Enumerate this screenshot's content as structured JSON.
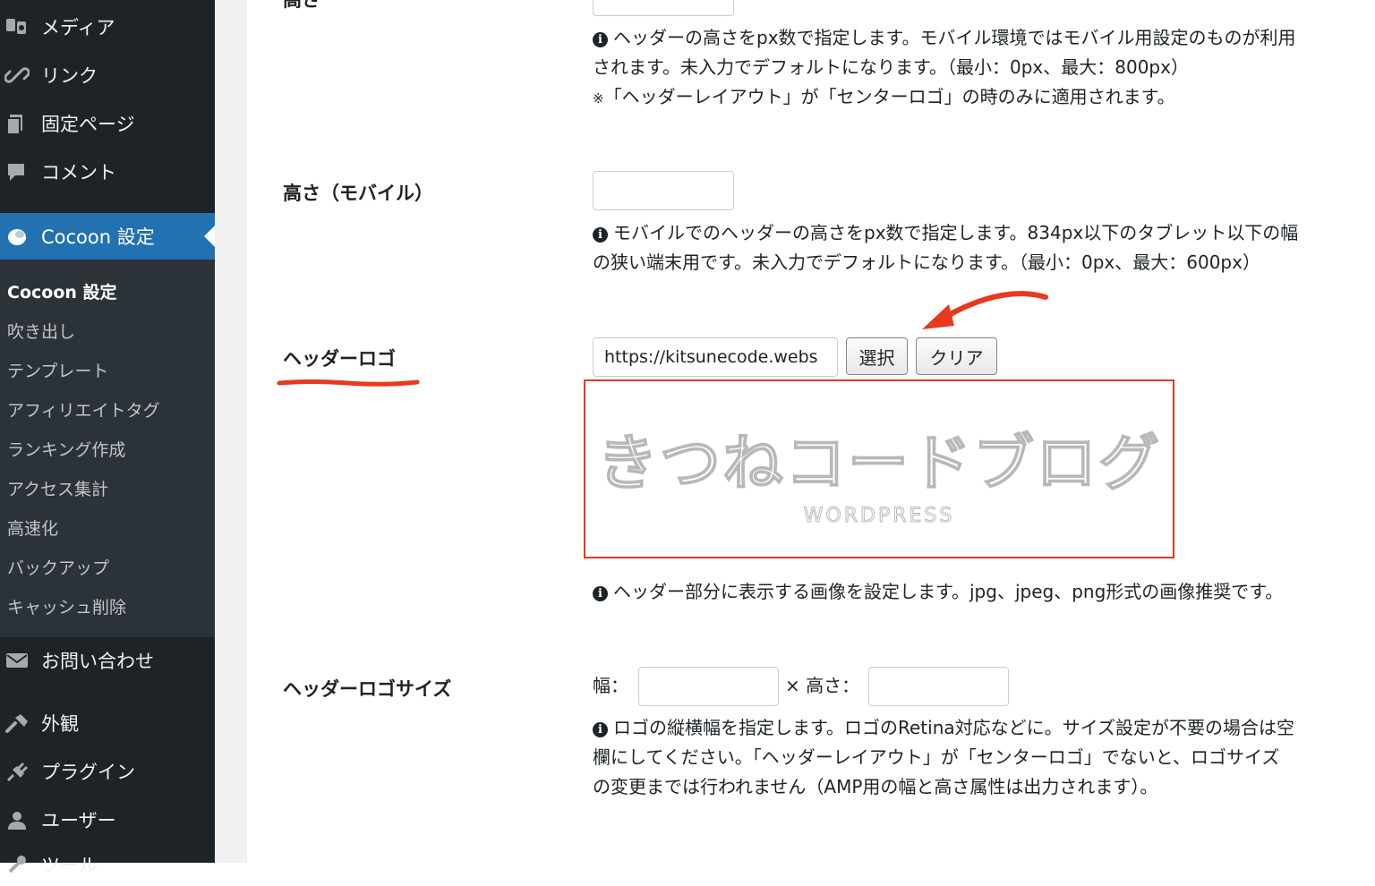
{
  "sidebar": {
    "items_top": [
      {
        "label": "メディア",
        "icon": "media-icon"
      },
      {
        "label": "リンク",
        "icon": "link-icon"
      },
      {
        "label": "固定ページ",
        "icon": "pages-icon"
      },
      {
        "label": "コメント",
        "icon": "comment-icon"
      }
    ],
    "active": {
      "label": "Cocoon 設定",
      "icon": "cocoon-icon"
    },
    "submenu": [
      "Cocoon 設定",
      "吹き出し",
      "テンプレート",
      "アフィリエイトタグ",
      "ランキング作成",
      "アクセス集計",
      "高速化",
      "バックアップ",
      "キャッシュ削除"
    ],
    "items_bottom": [
      {
        "label": "お問い合わせ",
        "icon": "mail-icon"
      },
      {
        "label": "外観",
        "icon": "appearance-icon"
      },
      {
        "label": "プラグイン",
        "icon": "plugin-icon"
      },
      {
        "label": "ユーザー",
        "icon": "user-icon"
      },
      {
        "label": "ツール",
        "icon": "tools-icon"
      }
    ]
  },
  "height_section": {
    "label": "高さ",
    "desc_line1": "ヘッダーの高さをpx数で指定します。モバイル環境ではモバイル用設定のものが利用",
    "desc_line2": "されます。未入力でデフォルトになります。（最小：0px、最大：800px）",
    "note_mark": "※",
    "note": "「ヘッダーレイアウト」が「センターロゴ」の時のみに適用されます。"
  },
  "mobile_height": {
    "label": "高さ（モバイル）",
    "desc_line1": "モバイルでのヘッダーの高さをpx数で指定します。834px以下のタブレット以下の幅",
    "desc_line2": "の狭い端末用です。未入力でデフォルトになります。（最小：0px、最大：600px）"
  },
  "header_logo": {
    "label": "ヘッダーロゴ",
    "url_value": "https://kitsunecode.webs",
    "select_label": "選択",
    "clear_label": "クリア",
    "logo_text": "きつねコードブログ",
    "logo_subtext": "WORDPRESS",
    "desc": "ヘッダー部分に表示する画像を設定します。jpg、jpeg、png形式の画像推奨です。"
  },
  "logo_size": {
    "label": "ヘッダーロゴサイズ",
    "width_label": "幅：",
    "height_label": "× 高さ：",
    "desc_line1": "ロゴの縦横幅を指定します。ロゴのRetina対応などに。サイズ設定が不要の場合は空",
    "desc_line2": "欄にしてください。「ヘッダーレイアウト」が「センターロゴ」でないと、ロゴサイズ",
    "desc_line3": "の変更までは行われません（AMP用の幅と高さ属性は出力されます）。"
  },
  "info_icon_glyph": "i",
  "colors": {
    "sidebar_bg": "#1d2327",
    "active_bg": "#2271b1",
    "annotation_red": "#e8391c"
  }
}
